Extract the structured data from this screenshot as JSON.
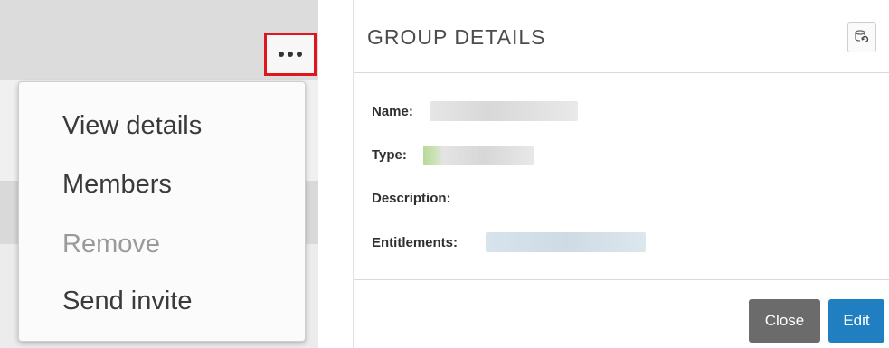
{
  "row_menu": {
    "items": [
      {
        "label": "View details",
        "enabled": true
      },
      {
        "label": "Members",
        "enabled": true
      },
      {
        "label": "Remove",
        "enabled": false
      },
      {
        "label": "Send invite",
        "enabled": true
      }
    ]
  },
  "more_button": {
    "icon": "more-horizontal-icon",
    "highlight_color": "#e0161f"
  },
  "dialog": {
    "title": "GROUP DETAILS",
    "refresh_icon": "refresh-icon",
    "fields": {
      "name_label": "Name:",
      "type_label": "Type:",
      "description_label": "Description:",
      "entitlements_label": "Entitlements:"
    },
    "buttons": {
      "close": "Close",
      "edit": "Edit"
    },
    "colors": {
      "edit": "#1f7fc1",
      "close": "#6b6b6b"
    }
  }
}
